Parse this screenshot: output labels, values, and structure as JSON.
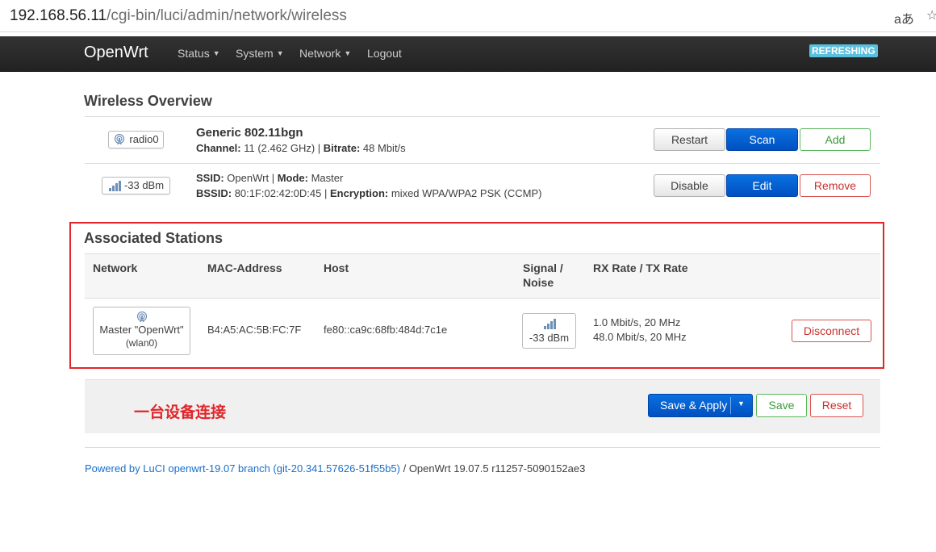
{
  "browser": {
    "url_host": "192.168.56.11",
    "url_path": "/cgi-bin/luci/admin/network/wireless",
    "translate_glyph": "aあ",
    "favorite_glyph": "☆"
  },
  "navbar": {
    "brand": "OpenWrt",
    "menus": [
      "Status",
      "System",
      "Network",
      "Logout"
    ],
    "refreshing": "REFRESHING",
    "refreshing_color": "#5bc0de"
  },
  "wireless": {
    "title": "Wireless Overview",
    "device": {
      "badge": "radio0",
      "name": "Generic 802.11bgn",
      "channel_label": "Channel:",
      "channel": "11 (2.462 GHz)",
      "bitrate_label": "Bitrate:",
      "bitrate": "48 Mbit/s",
      "buttons": {
        "restart": "Restart",
        "scan": "Scan",
        "add": "Add"
      }
    },
    "network": {
      "badge": "-33 dBm",
      "ssid_label": "SSID:",
      "ssid": "OpenWrt",
      "mode_label": "Mode:",
      "mode": "Master",
      "bssid_label": "BSSID:",
      "bssid": "80:1F:02:42:0D:45",
      "encryption_label": "Encryption:",
      "encryption": "mixed WPA/WPA2 PSK (CCMP)",
      "buttons": {
        "disable": "Disable",
        "edit": "Edit",
        "remove": "Remove"
      }
    }
  },
  "stations": {
    "title": "Associated Stations",
    "headers": {
      "network": "Network",
      "mac": "MAC-Address",
      "host": "Host",
      "signal_1": "Signal /",
      "signal_2": "Noise",
      "rate": "RX Rate / TX Rate"
    },
    "row": {
      "network_1": "Master \"OpenWrt\"",
      "network_2": "(wlan0)",
      "mac": "B4:A5:AC:5B:FC:7F",
      "host": "fe80::ca9c:68fb:484d:7c1e",
      "signal": "-33 dBm",
      "rx": "1.0 Mbit/s, 20 MHz",
      "tx": "48.0 Mbit/s, 20 MHz",
      "disconnect": "Disconnect"
    }
  },
  "actions": {
    "note": "一台设备连接",
    "save_apply": "Save & Apply",
    "save": "Save",
    "reset": "Reset"
  },
  "footer": {
    "link": "Powered by LuCI openwrt-19.07 branch (git-20.341.57626-51f55b5)",
    "version": " / OpenWrt 19.07.5 r11257-5090152ae3"
  },
  "colors": {
    "primary": "#0a70e0",
    "positive": "#5cb85c",
    "negative": "#d9534f",
    "highlight_box": "#e0262a"
  }
}
